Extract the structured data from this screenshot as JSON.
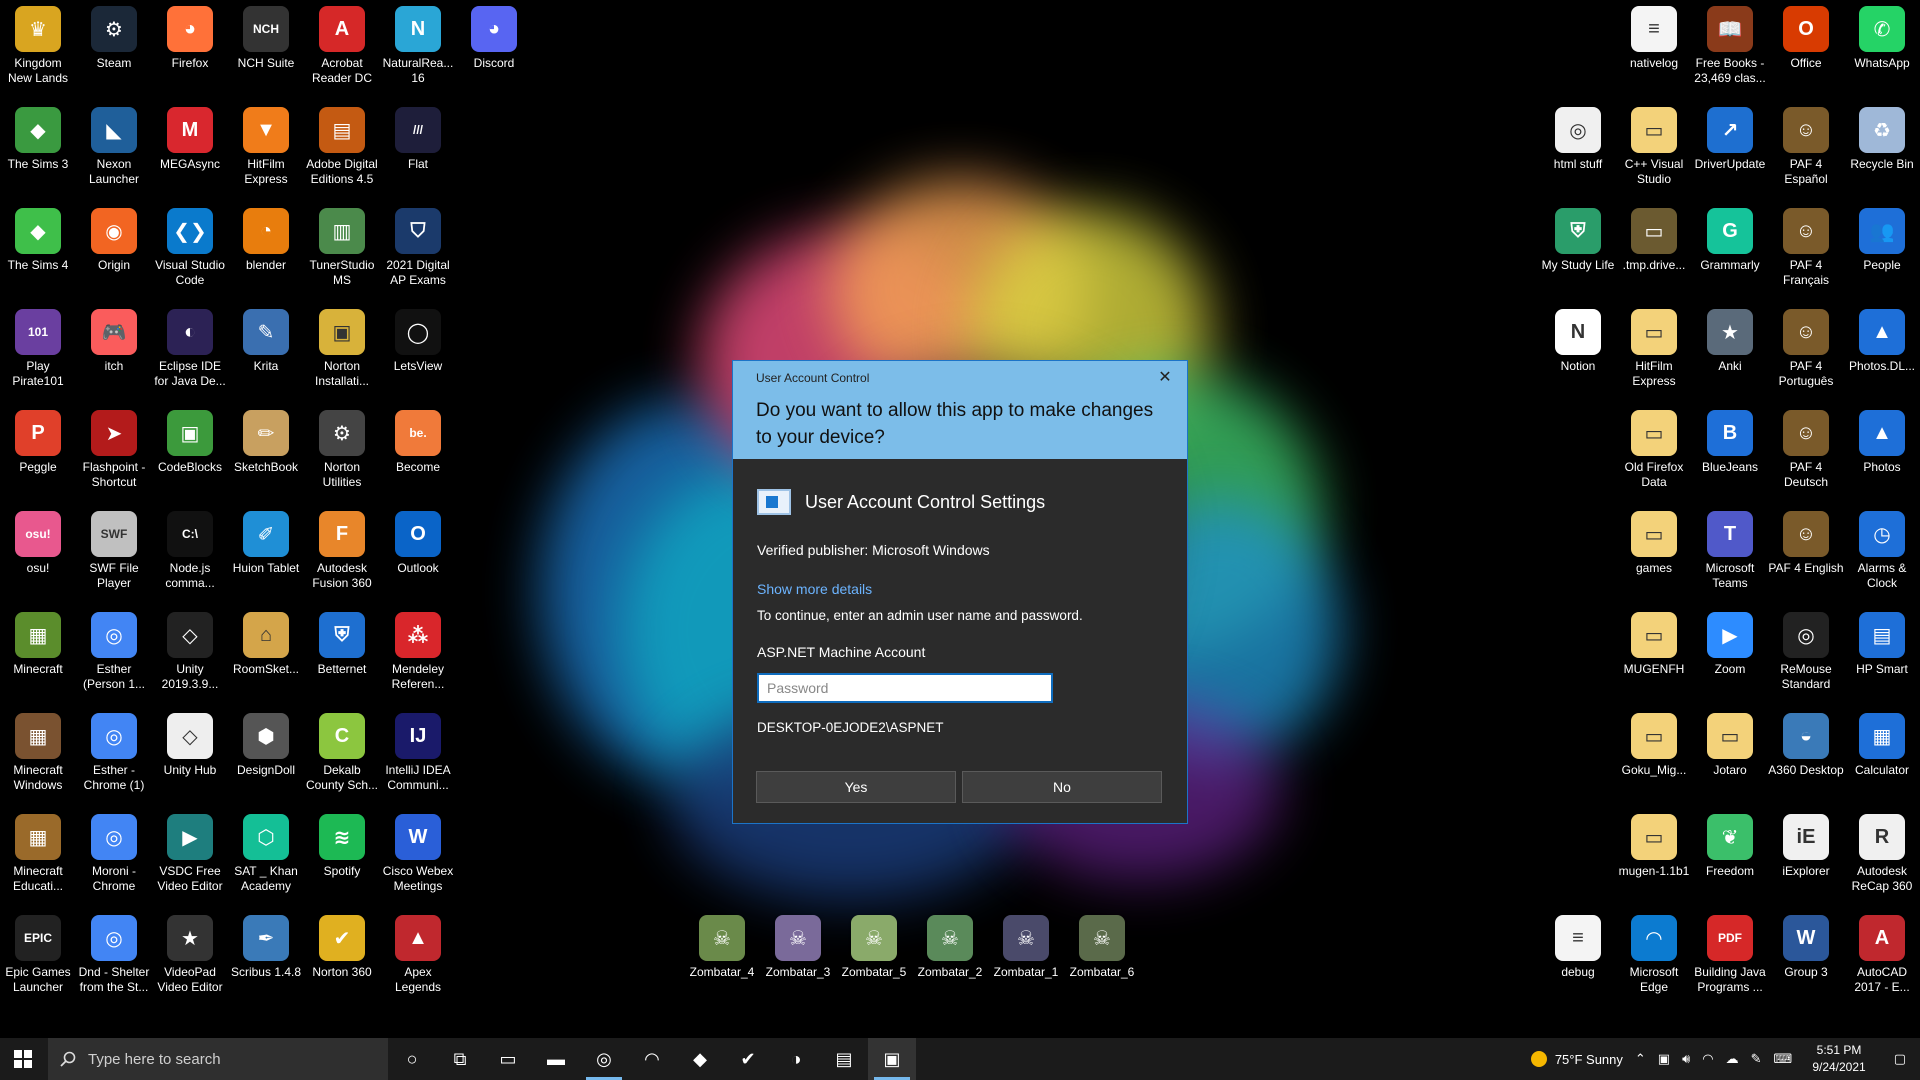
{
  "desktop": {
    "left_columns": [
      [
        {
          "label": "Kingdom\nNew Lands",
          "icon": "crown-icon",
          "color": "#d9a520",
          "glyph": "♛"
        },
        {
          "label": "The Sims 3",
          "icon": "plumbob-icon",
          "color": "#3a9a40",
          "glyph": "◆"
        },
        {
          "label": "The Sims 4",
          "icon": "plumbob-icon",
          "color": "#3fbf4a",
          "glyph": "◆"
        },
        {
          "label": "Play\nPirate101",
          "icon": "pirate-icon",
          "color": "#6a3fa0",
          "glyph": "101"
        },
        {
          "label": "Peggle",
          "icon": "peggle-icon",
          "color": "#e0402a",
          "glyph": "P"
        },
        {
          "label": "osu!",
          "icon": "osu-icon",
          "color": "#e8588e",
          "glyph": "osu!"
        },
        {
          "label": "Minecraft",
          "icon": "grass-block-icon",
          "color": "#5b8d2c",
          "glyph": "▦"
        },
        {
          "label": "Minecraft\nWindows",
          "icon": "dirt-block-icon",
          "color": "#7a5230",
          "glyph": "▦"
        },
        {
          "label": "Minecraft\nEducati...",
          "icon": "education-block-icon",
          "color": "#9a6a2a",
          "glyph": "▦"
        },
        {
          "label": "Epic Games\nLauncher",
          "icon": "epic-icon",
          "color": "#222222",
          "glyph": "EPIC"
        }
      ],
      [
        {
          "label": "Steam",
          "icon": "steam-icon",
          "color": "#1b2838",
          "glyph": "⚙"
        },
        {
          "label": "Nexon\nLauncher",
          "icon": "nexon-icon",
          "color": "#1f5f9a",
          "glyph": "◣"
        },
        {
          "label": "Origin",
          "icon": "origin-icon",
          "color": "#f26522",
          "glyph": "◉"
        },
        {
          "label": "itch",
          "icon": "itch-icon",
          "color": "#fa5c5c",
          "glyph": "🎮"
        },
        {
          "label": "Flashpoint -\nShortcut",
          "icon": "flashpoint-icon",
          "color": "#b31b1b",
          "glyph": "➤"
        },
        {
          "label": "SWF File\nPlayer",
          "icon": "swf-icon",
          "color": "#c0c0c0",
          "glyph": "SWF"
        },
        {
          "label": "Esther\n(Person 1...",
          "icon": "chrome-icon",
          "color": "#4285f4",
          "glyph": "◎"
        },
        {
          "label": "Esther -\nChrome (1)",
          "icon": "chrome-icon",
          "color": "#4285f4",
          "glyph": "◎"
        },
        {
          "label": "Moroni -\nChrome",
          "icon": "chrome-icon",
          "color": "#4285f4",
          "glyph": "◎"
        },
        {
          "label": "Dnd - Shelter\nfrom the St...",
          "icon": "chrome-icon",
          "color": "#4285f4",
          "glyph": "◎"
        }
      ],
      [
        {
          "label": "Firefox",
          "icon": "firefox-icon",
          "color": "#ff7139",
          "glyph": "◕"
        },
        {
          "label": "MEGAsync",
          "icon": "mega-icon",
          "color": "#d9272e",
          "glyph": "M"
        },
        {
          "label": "Visual Studio\nCode",
          "icon": "vscode-icon",
          "color": "#0a7acc",
          "glyph": "❮❯"
        },
        {
          "label": "Eclipse IDE\nfor Java De...",
          "icon": "eclipse-icon",
          "color": "#2c2255",
          "glyph": "◐"
        },
        {
          "label": "CodeBlocks",
          "icon": "codeblocks-icon",
          "color": "#3c9a3c",
          "glyph": "▣"
        },
        {
          "label": "Node.js\ncomma...",
          "icon": "terminal-icon",
          "color": "#111111",
          "glyph": "C:\\"
        },
        {
          "label": "Unity\n2019.3.9...",
          "icon": "unity-icon",
          "color": "#222222",
          "glyph": "◇"
        },
        {
          "label": "Unity Hub",
          "icon": "unity-hub-icon",
          "color": "#eeeeee",
          "glyph": "◇"
        },
        {
          "label": "VSDC Free\nVideo Editor",
          "icon": "vsdc-icon",
          "color": "#1e7e7e",
          "glyph": "▶"
        },
        {
          "label": "VideoPad\nVideo Editor",
          "icon": "videopad-icon",
          "color": "#333333",
          "glyph": "★"
        }
      ],
      [
        {
          "label": "NCH Suite",
          "icon": "nch-icon",
          "color": "#333333",
          "glyph": "NCH"
        },
        {
          "label": "HitFilm\nExpress",
          "icon": "hitfilm-icon",
          "color": "#f07c1a",
          "glyph": "▼"
        },
        {
          "label": "blender",
          "icon": "blender-icon",
          "color": "#e87d0d",
          "glyph": "◔"
        },
        {
          "label": "Krita",
          "icon": "krita-icon",
          "color": "#3a6fb0",
          "glyph": "✎"
        },
        {
          "label": "SketchBook",
          "icon": "pencil-icon",
          "color": "#c8a060",
          "glyph": "✏"
        },
        {
          "label": "Huion Tablet",
          "icon": "huion-icon",
          "color": "#1f8fd6",
          "glyph": "✐"
        },
        {
          "label": "RoomSket...",
          "icon": "roomsketcher-icon",
          "color": "#d4a54a",
          "glyph": "⌂"
        },
        {
          "label": "DesignDoll",
          "icon": "designdoll-icon",
          "color": "#555555",
          "glyph": "⬢"
        },
        {
          "label": "SAT _ Khan\nAcademy",
          "icon": "khan-icon",
          "color": "#14bf96",
          "glyph": "⬡"
        },
        {
          "label": "Scribus 1.4.8",
          "icon": "scribus-icon",
          "color": "#3a7ab8",
          "glyph": "✒"
        }
      ],
      [
        {
          "label": "Acrobat\nReader DC",
          "icon": "acrobat-icon",
          "color": "#d62828",
          "glyph": "A"
        },
        {
          "label": "Adobe Digital\nEditions 4.5",
          "icon": "adobe-de-icon",
          "color": "#c45a12",
          "glyph": "▤"
        },
        {
          "label": "TunerStudio\nMS",
          "icon": "tunerstudio-icon",
          "color": "#4b8a4b",
          "glyph": "▥"
        },
        {
          "label": "Norton\nInstallati...",
          "icon": "norton-installer-icon",
          "color": "#d8b23a",
          "glyph": "▣"
        },
        {
          "label": "Norton\nUtilities",
          "icon": "norton-utilities-icon",
          "color": "#444444",
          "glyph": "⚙"
        },
        {
          "label": "Autodesk\nFusion 360",
          "icon": "fusion-icon",
          "color": "#e8862a",
          "glyph": "F"
        },
        {
          "label": "Betternet",
          "icon": "betternet-icon",
          "color": "#1e6fd0",
          "glyph": "⛨"
        },
        {
          "label": "Dekalb\nCounty Sch...",
          "icon": "dekalb-icon",
          "color": "#8cc63f",
          "glyph": "C"
        },
        {
          "label": "Spotify",
          "icon": "spotify-icon",
          "color": "#1db954",
          "glyph": "≋"
        },
        {
          "label": "Norton 360",
          "icon": "norton-icon",
          "color": "#e0b020",
          "glyph": "✔"
        }
      ],
      [
        {
          "label": "NaturalRea...\n16",
          "icon": "naturalreader-icon",
          "color": "#2aa6d6",
          "glyph": "N"
        },
        {
          "label": "Flat",
          "icon": "flat-icon",
          "color": "#1e1e3a",
          "glyph": "///"
        },
        {
          "label": "2021 Digital\nAP Exams",
          "icon": "ap-exams-icon",
          "color": "#1b3a6b",
          "glyph": "⛉"
        },
        {
          "label": "LetsView",
          "icon": "letsview-icon",
          "color": "#111111",
          "glyph": "◯"
        },
        {
          "label": "Become",
          "icon": "behance-icon",
          "color": "#f07a3a",
          "glyph": "be."
        },
        {
          "label": "Outlook",
          "icon": "outlook-icon",
          "color": "#0a64c8",
          "glyph": "O"
        },
        {
          "label": "Mendeley\nReferen...",
          "icon": "mendeley-icon",
          "color": "#d9262b",
          "glyph": "⁂"
        },
        {
          "label": "IntelliJ IDEA\nCommuni...",
          "icon": "intellij-icon",
          "color": "#1a1a6a",
          "glyph": "IJ"
        },
        {
          "label": "Cisco Webex\nMeetings",
          "icon": "webex-icon",
          "color": "#2a5fd8",
          "glyph": "W"
        },
        {
          "label": "Apex\nLegends",
          "icon": "apex-icon",
          "color": "#c0282e",
          "glyph": "▲"
        }
      ],
      [
        {
          "label": "Discord",
          "icon": "discord-icon",
          "color": "#5865f2",
          "glyph": "◕"
        }
      ]
    ],
    "right_columns": [
      [
        {
          "label": "",
          "icon": "",
          "color": "",
          "glyph": ""
        },
        {
          "label": "html stuff",
          "icon": "chrome-file-icon",
          "color": "#f0f0f0",
          "glyph": "◎"
        },
        {
          "label": "My Study Life",
          "icon": "mystudylife-icon",
          "color": "#2a9d6a",
          "glyph": "⛨"
        },
        {
          "label": "Notion",
          "icon": "notion-icon",
          "color": "#ffffff",
          "glyph": "N"
        },
        {
          "label": "",
          "icon": "",
          "color": "",
          "glyph": ""
        },
        {
          "label": "",
          "icon": "",
          "color": "",
          "glyph": ""
        },
        {
          "label": "",
          "icon": "",
          "color": "",
          "glyph": ""
        },
        {
          "label": "",
          "icon": "",
          "color": "",
          "glyph": ""
        },
        {
          "label": "",
          "icon": "",
          "color": "",
          "glyph": ""
        },
        {
          "label": "debug",
          "icon": "text-file-icon",
          "color": "#f4f4f4",
          "glyph": "≡"
        }
      ],
      [
        {
          "label": "nativelog",
          "icon": "text-file-icon",
          "color": "#f4f4f4",
          "glyph": "≡"
        },
        {
          "label": "C++ Visual\nStudio",
          "icon": "folder-icon",
          "color": "#f3d27a",
          "glyph": "▭"
        },
        {
          "label": ".tmp.drive...",
          "icon": "folder-icon",
          "color": "#6b5a30",
          "glyph": "▭"
        },
        {
          "label": "HitFilm\nExpress",
          "icon": "folder-icon",
          "color": "#f3d27a",
          "glyph": "▭"
        },
        {
          "label": "Old Firefox\nData",
          "icon": "folder-icon",
          "color": "#f3d27a",
          "glyph": "▭"
        },
        {
          "label": "games",
          "icon": "folder-icon",
          "color": "#f3d27a",
          "glyph": "▭"
        },
        {
          "label": "MUGENFH",
          "icon": "folder-icon",
          "color": "#f3d27a",
          "glyph": "▭"
        },
        {
          "label": "Goku_Mig...",
          "icon": "folder-icon",
          "color": "#f3d27a",
          "glyph": "▭"
        },
        {
          "label": "mugen-1.1b1",
          "icon": "folder-icon",
          "color": "#f3d27a",
          "glyph": "▭"
        },
        {
          "label": "Microsoft\nEdge",
          "icon": "edge-icon",
          "color": "#0c7bd0",
          "glyph": "◠"
        }
      ],
      [
        {
          "label": "Free Books -\n23,469 clas...",
          "icon": "books-icon",
          "color": "#8a3a1a",
          "glyph": "📖"
        },
        {
          "label": "DriverUpdate",
          "icon": "driverupdate-icon",
          "color": "#1e6fd0",
          "glyph": "↗"
        },
        {
          "label": "Grammarly",
          "icon": "grammarly-icon",
          "color": "#15c39a",
          "glyph": "G"
        },
        {
          "label": "Anki",
          "icon": "anki-icon",
          "color": "#5a6a7a",
          "glyph": "★"
        },
        {
          "label": "BlueJeans",
          "icon": "bluejeans-icon",
          "color": "#1e6fd8",
          "glyph": "B"
        },
        {
          "label": "Microsoft\nTeams",
          "icon": "teams-icon",
          "color": "#5059c9",
          "glyph": "T"
        },
        {
          "label": "Zoom",
          "icon": "zoom-icon",
          "color": "#2d8cff",
          "glyph": "▶"
        },
        {
          "label": "Jotaro",
          "icon": "folder-icon",
          "color": "#f3d27a",
          "glyph": "▭"
        },
        {
          "label": "Freedom",
          "icon": "freedom-icon",
          "color": "#3bbf6a",
          "glyph": "❦"
        },
        {
          "label": "Building Java\nPrograms ...",
          "icon": "pdf-icon",
          "color": "#d62828",
          "glyph": "PDF"
        }
      ],
      [
        {
          "label": "Office",
          "icon": "office-icon",
          "color": "#d83b01",
          "glyph": "O"
        },
        {
          "label": "PAF 4\nEspañol",
          "icon": "paf-icon",
          "color": "#7a5a2a",
          "glyph": "☺"
        },
        {
          "label": "PAF 4\nFrançais",
          "icon": "paf-icon",
          "color": "#7a5a2a",
          "glyph": "☺"
        },
        {
          "label": "PAF 4\nPortuguês",
          "icon": "paf-icon",
          "color": "#7a5a2a",
          "glyph": "☺"
        },
        {
          "label": "PAF 4\nDeutsch",
          "icon": "paf-icon",
          "color": "#7a5a2a",
          "glyph": "☺"
        },
        {
          "label": "PAF 4 English",
          "icon": "paf-icon",
          "color": "#7a5a2a",
          "glyph": "☺"
        },
        {
          "label": "ReMouse\nStandard",
          "icon": "remouse-icon",
          "color": "#222222",
          "glyph": "◎"
        },
        {
          "label": "A360 Desktop",
          "icon": "a360-icon",
          "color": "#3a7ab8",
          "glyph": "◒"
        },
        {
          "label": "iExplorer",
          "icon": "iexplorer-icon",
          "color": "#f0f0f0",
          "glyph": "iE"
        },
        {
          "label": "Group 3",
          "icon": "word-icon",
          "color": "#2b579a",
          "glyph": "W"
        }
      ],
      [
        {
          "label": "WhatsApp",
          "icon": "whatsapp-icon",
          "color": "#25d366",
          "glyph": "✆"
        },
        {
          "label": "Recycle Bin",
          "icon": "recycle-bin-icon",
          "color": "#9fb8d8",
          "glyph": "♻"
        },
        {
          "label": "People",
          "icon": "people-icon",
          "color": "#1e6fd8",
          "glyph": "👥"
        },
        {
          "label": "Photos.DL...",
          "icon": "photos-icon",
          "color": "#1e6fd8",
          "glyph": "▲"
        },
        {
          "label": "Photos",
          "icon": "photos-icon",
          "color": "#1e6fd8",
          "glyph": "▲"
        },
        {
          "label": "Alarms &\nClock",
          "icon": "clock-icon",
          "color": "#1e6fd8",
          "glyph": "◷"
        },
        {
          "label": "HP Smart",
          "icon": "hpsmart-icon",
          "color": "#1e6fd8",
          "glyph": "▤"
        },
        {
          "label": "Calculator",
          "icon": "calculator-icon",
          "color": "#1e6fd8",
          "glyph": "▦"
        },
        {
          "label": "Autodesk\nReCap 360",
          "icon": "recap-icon",
          "color": "#f0f0f0",
          "glyph": "R"
        },
        {
          "label": "AutoCAD\n2017 - E...",
          "icon": "autocad-icon",
          "color": "#c0282e",
          "glyph": "A"
        }
      ]
    ],
    "bottom_row": [
      {
        "label": "Zombatar_4",
        "icon": "zombie-icon",
        "color": "#6a8a4a",
        "glyph": "☠"
      },
      {
        "label": "Zombatar_3",
        "icon": "zombie-icon",
        "color": "#7a6a9a",
        "glyph": "☠"
      },
      {
        "label": "Zombatar_5",
        "icon": "zombie-icon",
        "color": "#8aaa6a",
        "glyph": "☠"
      },
      {
        "label": "Zombatar_2",
        "icon": "zombie-icon",
        "color": "#5a8a5a",
        "glyph": "☠"
      },
      {
        "label": "Zombatar_1",
        "icon": "zombie-icon",
        "color": "#4a4a6a",
        "glyph": "☠"
      },
      {
        "label": "Zombatar_6",
        "icon": "zombie-icon",
        "color": "#5a6a4a",
        "glyph": "☠"
      }
    ]
  },
  "uac": {
    "caption": "User Account Control",
    "close_glyph": "✕",
    "question": "Do you want to allow this app to make changes to your device?",
    "app_name": "User Account Control Settings",
    "publisher": "Verified publisher: Microsoft Windows",
    "more_details": "Show more details",
    "instructions": "To continue, enter an admin user name and password.",
    "account_name": "ASP.NET Machine Account",
    "password_placeholder": "Password",
    "account_path": "DESKTOP-0EJODE2\\ASPNET",
    "yes_label": "Yes",
    "no_label": "No",
    "header_color": "#7cbde9"
  },
  "taskbar": {
    "search_placeholder": "Type here to search",
    "weather": "75°F  Sunny",
    "time": "5:51 PM",
    "date": "9/24/2021",
    "pinned": [
      {
        "name": "cortana-icon",
        "glyph": "○"
      },
      {
        "name": "task-view-icon",
        "glyph": "⧉"
      },
      {
        "name": "terminal-icon",
        "glyph": "▭"
      },
      {
        "name": "file-explorer-icon",
        "glyph": "▬"
      },
      {
        "name": "chrome-icon",
        "glyph": "◎"
      },
      {
        "name": "edge-icon",
        "glyph": "◠"
      },
      {
        "name": "notes-icon",
        "glyph": "◆"
      },
      {
        "name": "todo-icon",
        "glyph": "✔"
      },
      {
        "name": "krita-icon",
        "glyph": "◑"
      },
      {
        "name": "paf-icon",
        "glyph": "▤"
      },
      {
        "name": "uac-settings-icon",
        "glyph": "▣"
      }
    ]
  }
}
